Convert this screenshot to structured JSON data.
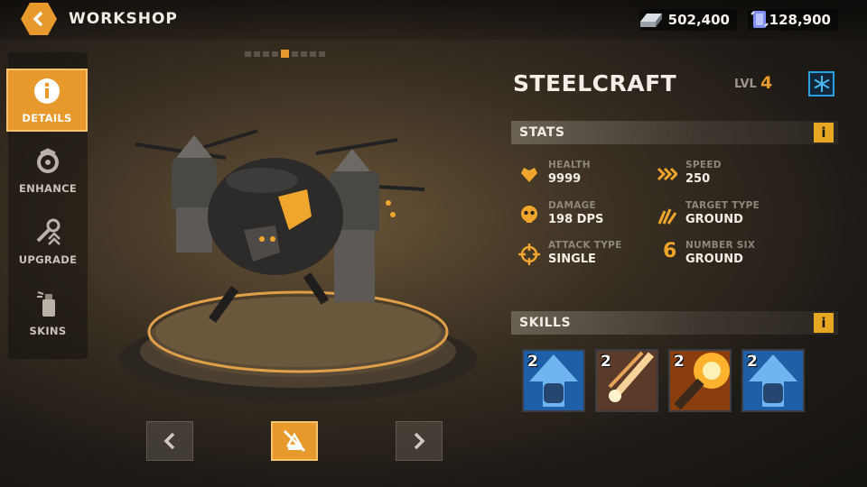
{
  "header": {
    "title": "WORKSHOP"
  },
  "currencies": [
    {
      "icon": "steel-ingot-icon",
      "value": "502,400"
    },
    {
      "icon": "crystal-icon",
      "value": "128,900"
    }
  ],
  "sidebar": {
    "items": [
      {
        "label": "DETAILS",
        "icon": "info-icon",
        "active": true
      },
      {
        "label": "ENHANCE",
        "icon": "enhance-icon",
        "active": false
      },
      {
        "label": "UPGRADE",
        "icon": "wrench-upgrade-icon",
        "active": false
      },
      {
        "label": "SKINS",
        "icon": "spray-can-icon",
        "active": false
      }
    ]
  },
  "pager": {
    "total": 9,
    "current": 5
  },
  "unit": {
    "name": "STEELCRAFT",
    "level_label": "LVL",
    "level": "4"
  },
  "stats": {
    "title": "STATS",
    "info": "i",
    "items": [
      {
        "label": "HEALTH",
        "value": "9999",
        "icon": "heart-icon"
      },
      {
        "label": "SPEED",
        "value": "250",
        "icon": "speed-chevrons-icon"
      },
      {
        "label": "DAMAGE",
        "value": "198 DPS",
        "icon": "skull-icon"
      },
      {
        "label": "TARGET TYPE",
        "value": "GROUND",
        "icon": "claw-icon"
      },
      {
        "label": "ATTACK TYPE",
        "value": "SINGLE",
        "icon": "crosshair-icon"
      },
      {
        "label": "NUMBER SIX",
        "value": "GROUND",
        "icon": "number-six-icon",
        "glyph": "6"
      }
    ]
  },
  "skills": {
    "title": "SKILLS",
    "info": "i",
    "items": [
      {
        "level": "2",
        "icon": "fist-up-arrow-icon"
      },
      {
        "level": "2",
        "icon": "meteor-strike-icon"
      },
      {
        "level": "2",
        "icon": "cannon-blast-icon"
      },
      {
        "level": "2",
        "icon": "fist-up-arrow-icon"
      }
    ]
  },
  "colors": {
    "accent": "#e79a2b",
    "freeze": "#2aa0e3",
    "info": "#e8a722"
  }
}
